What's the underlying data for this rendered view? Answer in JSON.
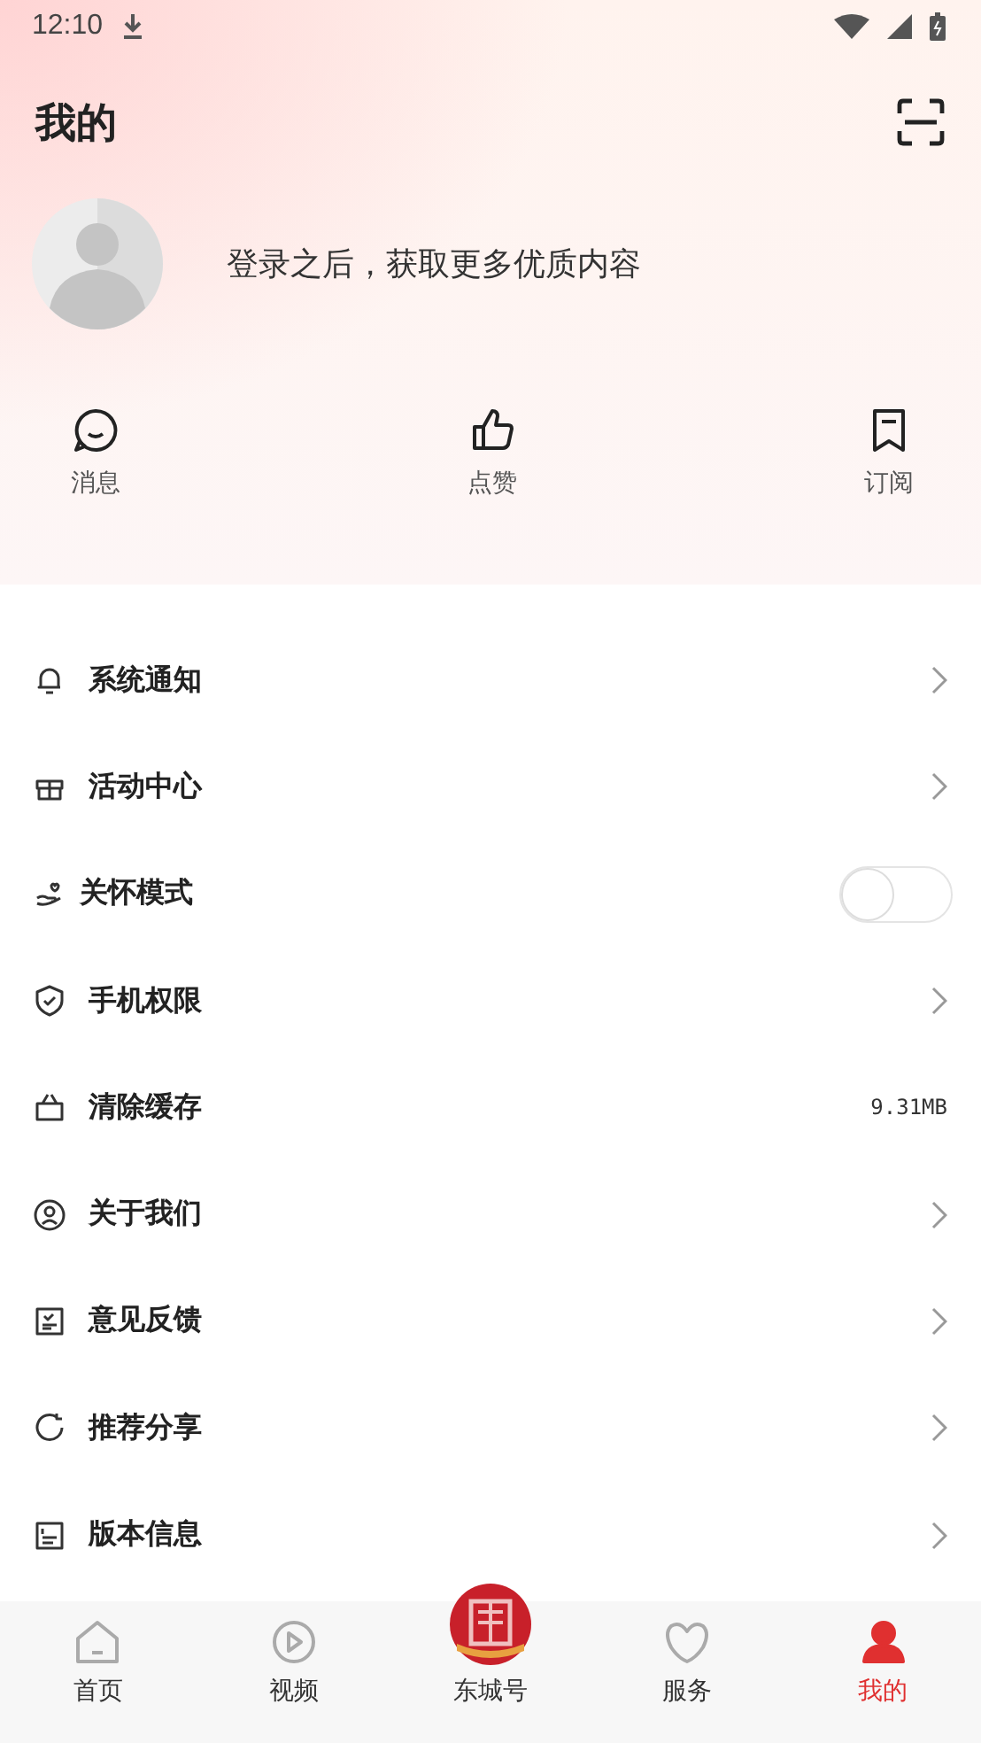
{
  "status_bar": {
    "time": "12:10"
  },
  "header": {
    "title": "我的"
  },
  "profile": {
    "prompt": "登录之后，获取更多优质内容"
  },
  "quick_actions": [
    {
      "label": "消息"
    },
    {
      "label": "点赞"
    },
    {
      "label": "订阅"
    }
  ],
  "menu": [
    {
      "kind": "link",
      "label": "系统通知"
    },
    {
      "kind": "link",
      "label": "活动中心"
    },
    {
      "kind": "toggle",
      "label": "关怀模式",
      "on": false
    },
    {
      "kind": "link",
      "label": "手机权限"
    },
    {
      "kind": "value",
      "label": "清除缓存",
      "value": "9.31MB"
    },
    {
      "kind": "link",
      "label": "关于我们"
    },
    {
      "kind": "link",
      "label": "意见反馈"
    },
    {
      "kind": "link",
      "label": "推荐分享"
    },
    {
      "kind": "link",
      "label": "版本信息"
    }
  ],
  "tabs": [
    {
      "label": "首页",
      "selected": false
    },
    {
      "label": "视频",
      "selected": false
    },
    {
      "label": "东城号",
      "selected": false
    },
    {
      "label": "服务",
      "selected": false
    },
    {
      "label": "我的",
      "selected": true
    }
  ]
}
